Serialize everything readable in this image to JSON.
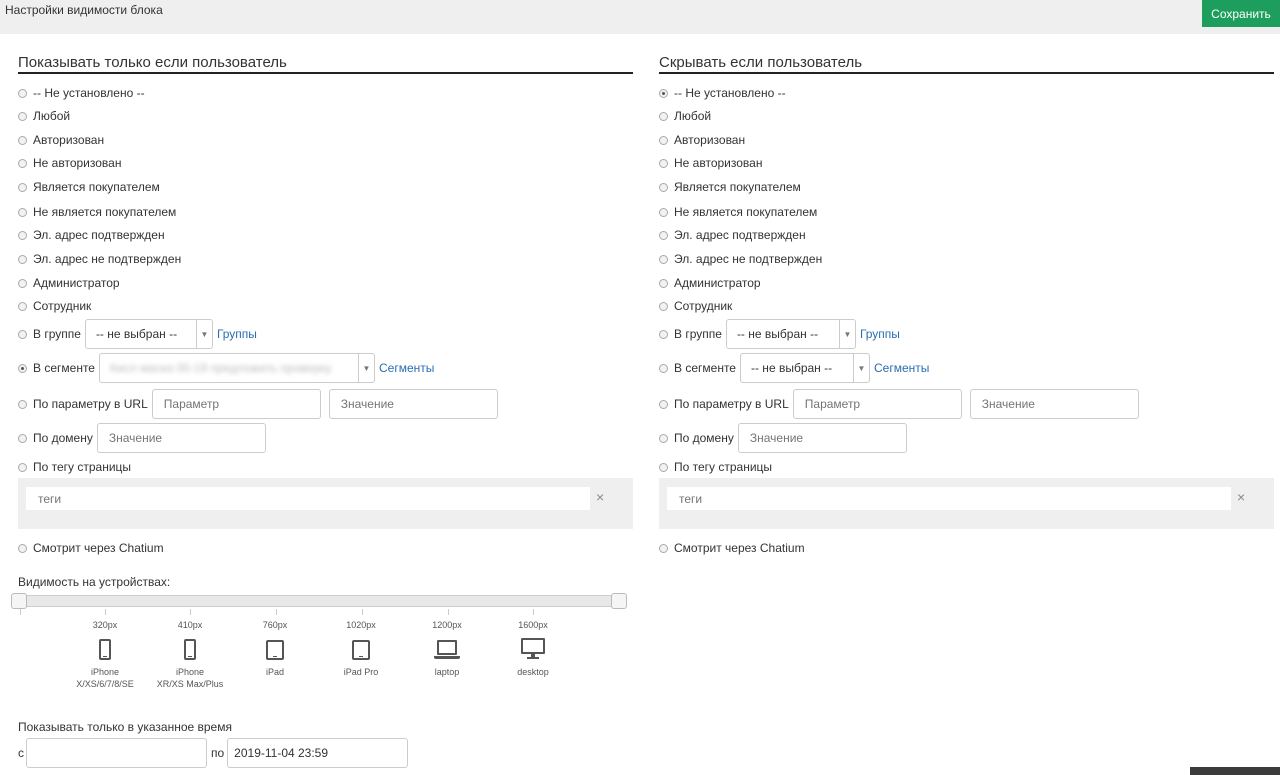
{
  "header": {
    "title": "Настройки видимости блока",
    "save_label": "Сохранить"
  },
  "left": {
    "title": "Показывать только если пользователь",
    "options": [
      "-- Не установлено --",
      "Любой",
      "Авторизован",
      "Не авторизован",
      "Является покупателем",
      "Не является покупателем",
      "Эл. адрес подтвержден",
      "Эл. адрес не подтвержден",
      "Администратор",
      "Сотрудник"
    ],
    "group": {
      "label": "В группе",
      "value": "-- не выбран --",
      "link": "Группы"
    },
    "segment": {
      "label": "В сегменте",
      "value": "Кисл маска 00-19 предложить проверку",
      "link": "Сегменты"
    },
    "url_param": {
      "label": "По параметру в URL",
      "param_placeholder": "Параметр",
      "value_placeholder": "Значение"
    },
    "domain": {
      "label": "По домену",
      "placeholder": "Значение"
    },
    "page_tag": {
      "label": "По тегу страницы",
      "placeholder": "теги",
      "clear": "×"
    },
    "chatium": "Смотрит через Chatium",
    "selected": "segment"
  },
  "right": {
    "title": "Скрывать если пользователь",
    "options": [
      "-- Не установлено --",
      "Любой",
      "Авторизован",
      "Не авторизован",
      "Является покупателем",
      "Не является покупателем",
      "Эл. адрес подтвержден",
      "Эл. адрес не подтвержден",
      "Администратор",
      "Сотрудник"
    ],
    "group": {
      "label": "В группе",
      "value": "-- не выбран --",
      "link": "Группы"
    },
    "segment": {
      "label": "В сегменте",
      "value": "-- не выбран --",
      "link": "Сегменты"
    },
    "url_param": {
      "label": "По параметру в URL",
      "param_placeholder": "Параметр",
      "value_placeholder": "Значение"
    },
    "domain": {
      "label": "По домену",
      "placeholder": "Значение"
    },
    "page_tag": {
      "label": "По тегу страницы",
      "placeholder": "теги",
      "clear": "×"
    },
    "chatium": "Смотрит через Chatium",
    "selected": "option-0"
  },
  "devices": {
    "title": "Видимость на устройствах:",
    "range": [
      0,
      1
    ],
    "items": [
      {
        "px": "320px",
        "name": "iPhone",
        "name2": "X/XS/6/7/8/SE",
        "icon": "phone-icon"
      },
      {
        "px": "410px",
        "name": "iPhone",
        "name2": "XR/XS Max/Plus",
        "icon": "phone-icon"
      },
      {
        "px": "760px",
        "name": "iPad",
        "name2": "",
        "icon": "tablet-icon"
      },
      {
        "px": "1020px",
        "name": "iPad Pro",
        "name2": "",
        "icon": "tablet-icon"
      },
      {
        "px": "1200px",
        "name": "laptop",
        "name2": "",
        "icon": "laptop-icon"
      },
      {
        "px": "1600px",
        "name": "desktop",
        "name2": "",
        "icon": "desktop-icon"
      }
    ]
  },
  "time": {
    "title": "Показывать только в указанное время",
    "from_label": "с",
    "from_value": "",
    "to_label": "по",
    "to_value": "2019-11-04 23:59"
  }
}
